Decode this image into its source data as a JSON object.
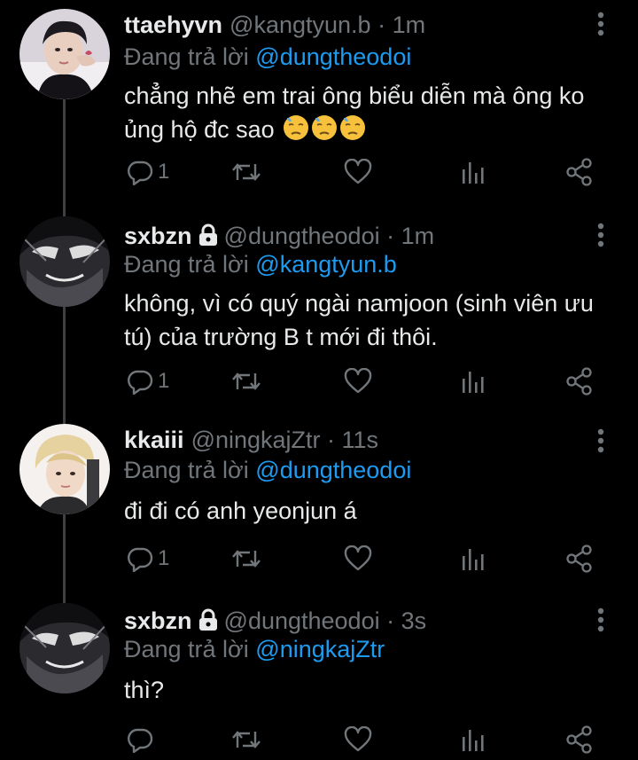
{
  "tweets": [
    {
      "name": "ttaehyvn",
      "handle": "@kangtyun.b",
      "time": "1m",
      "reply_prefix": "Đang trả lời",
      "reply_mention": "@dungtheodoi",
      "text_line1": "chẳng nhẽ em trai ông biểu diễn mà ông ko",
      "text_line2": "ủng hộ đc sao",
      "emoji": [
        "😓",
        "😓",
        "😓"
      ],
      "reply_count": "1",
      "locked": false
    },
    {
      "name": "sxbzn",
      "handle": "@dungtheodoi",
      "time": "1m",
      "reply_prefix": "Đang trả lời",
      "reply_mention": "@kangtyun.b",
      "text_line1": "không, vì có quý ngài namjoon (sinh viên ưu",
      "text_line2": "tú) của trường B t mới đi thôi.",
      "reply_count": "1",
      "locked": true
    },
    {
      "name": "kkaiii",
      "handle": "@ningkajZtr",
      "time": "11s",
      "reply_prefix": "Đang trả lời",
      "reply_mention": "@dungtheodoi",
      "text_line1": "đi đi có anh yeonjun á",
      "reply_count": "1",
      "locked": false
    },
    {
      "name": "sxbzn",
      "handle": "@dungtheodoi",
      "time": "3s",
      "reply_prefix": "Đang trả lời",
      "reply_mention": "@ningkajZtr",
      "text_line1": "thì?",
      "reply_count": "",
      "locked": true
    }
  ],
  "icons": {
    "reply": "reply-icon",
    "retweet": "retweet-icon",
    "like": "heart-icon",
    "views": "views-icon",
    "share": "share-icon",
    "more": "more-vertical-icon",
    "lock": "lock-icon"
  },
  "colors": {
    "background": "#000000",
    "text": "#e7e9ea",
    "muted": "#71767b",
    "mention": "#1d9bf0",
    "thread_line": "#3e4144"
  }
}
